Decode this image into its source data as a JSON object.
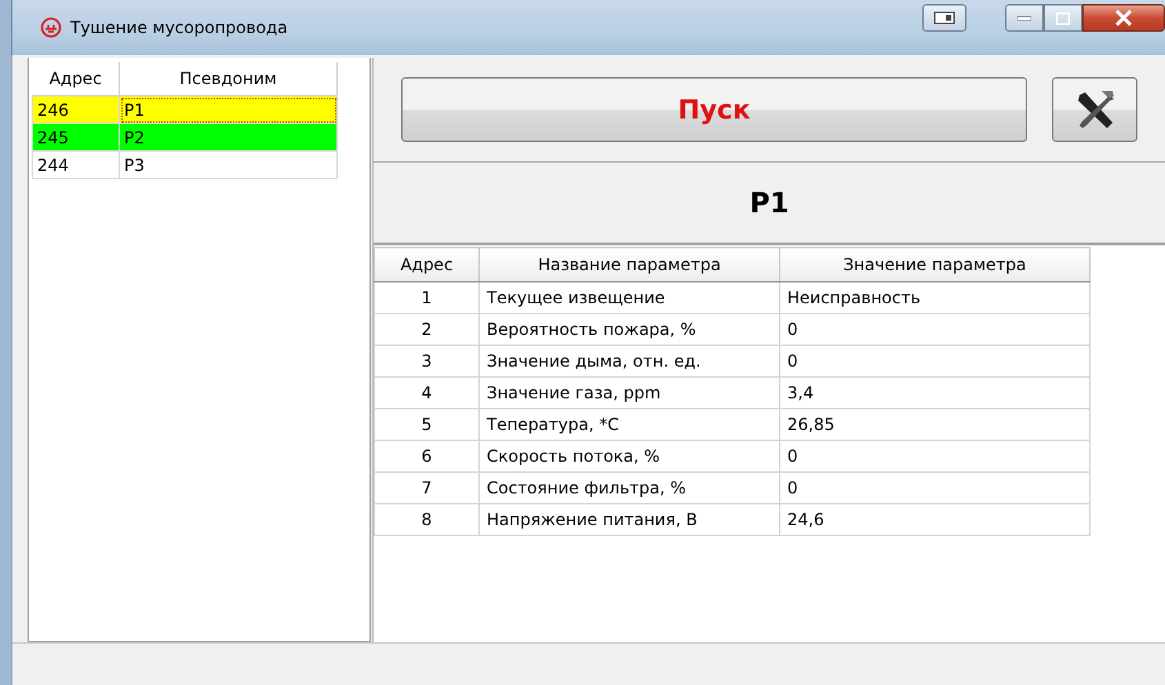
{
  "window": {
    "title": "Тушение мусоропровода"
  },
  "devices": {
    "columns": [
      "Адрес",
      "Псевдоним"
    ],
    "rows": [
      {
        "address": "246",
        "alias": "P1",
        "color": "#ffff00",
        "selected": true
      },
      {
        "address": "245",
        "alias": "P2",
        "color": "#00ff00",
        "selected": false
      },
      {
        "address": "244",
        "alias": "P3",
        "color": "#ffffff",
        "selected": false
      }
    ]
  },
  "start_button": {
    "label": "Пуск"
  },
  "device_title": "P1",
  "parameters": {
    "columns": [
      "Адрес",
      "Название параметра",
      "Значение параметра"
    ],
    "rows": [
      {
        "address": "1",
        "name": "Текущее извещение",
        "value": "Неисправность"
      },
      {
        "address": "2",
        "name": "Вероятность пожара, %",
        "value": "0"
      },
      {
        "address": "3",
        "name": "Значение дыма, отн. ед.",
        "value": "0"
      },
      {
        "address": "4",
        "name": "Значение газа, ppm",
        "value": "3,4"
      },
      {
        "address": "5",
        "name": "Тепература, *С",
        "value": "26,85"
      },
      {
        "address": "6",
        "name": "Скорость потока, %",
        "value": "0"
      },
      {
        "address": "7",
        "name": "Состояние фильтра, %",
        "value": "0"
      },
      {
        "address": "8",
        "name": "Напряжение питания, В",
        "value": "24,6"
      }
    ]
  }
}
